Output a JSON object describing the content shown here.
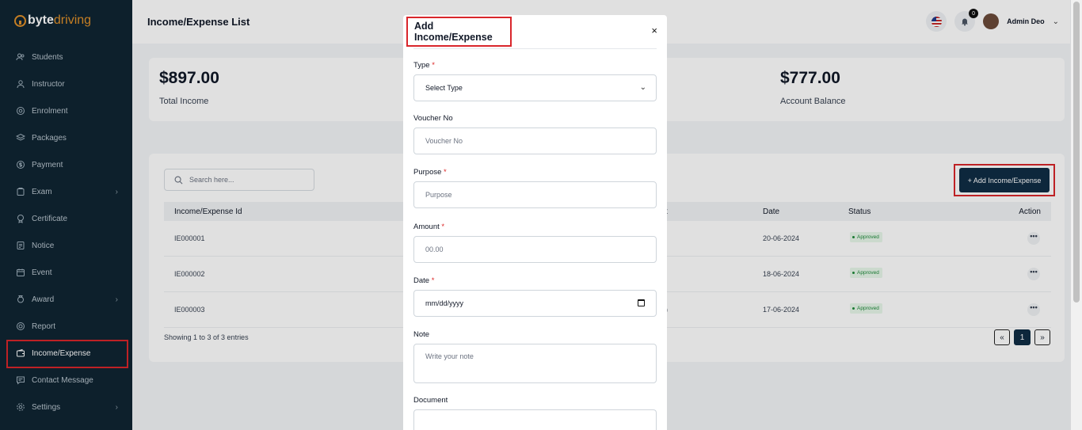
{
  "logo": {
    "part1": "byte",
    "part2": "driving"
  },
  "sidebar": {
    "items": [
      {
        "label": "Students",
        "icon": "users-icon"
      },
      {
        "label": "Instructor",
        "icon": "user-icon"
      },
      {
        "label": "Enrolment",
        "icon": "at-icon"
      },
      {
        "label": "Packages",
        "icon": "layers-icon"
      },
      {
        "label": "Payment",
        "icon": "dollar-icon"
      },
      {
        "label": "Exam",
        "icon": "clipboard-icon"
      },
      {
        "label": "Certificate",
        "icon": "certificate-icon"
      },
      {
        "label": "Notice",
        "icon": "note-icon"
      },
      {
        "label": "Event",
        "icon": "calendar-icon"
      },
      {
        "label": "Award",
        "icon": "award-icon"
      },
      {
        "label": "Report",
        "icon": "report-icon"
      },
      {
        "label": "Income/Expense",
        "icon": "wallet-icon"
      },
      {
        "label": "Contact Message",
        "icon": "message-icon"
      },
      {
        "label": "Settings",
        "icon": "gear-icon"
      }
    ]
  },
  "header": {
    "title": "Income/Expense List",
    "notifications": "0",
    "user": "Admin Deo"
  },
  "stats": [
    {
      "value": "$897.00",
      "label": "Total Income"
    },
    {
      "value": "$777.00",
      "label": "Account Balance"
    }
  ],
  "toolbar": {
    "search_placeholder": "Search here...",
    "add_label": "+ Add Income/Expense"
  },
  "table": {
    "headers": {
      "id": "Income/Expense Id",
      "amount_partial": "t",
      "date": "Date",
      "status": "Status",
      "action": "Action"
    },
    "rows": [
      {
        "id": "IE000001",
        "amount": "",
        "date": "20-06-2024",
        "status": "Approved"
      },
      {
        "id": "IE000002",
        "amount": "",
        "date": "18-06-2024",
        "status": "Approved"
      },
      {
        "id": "IE000003",
        "amount": ")",
        "date": "17-06-2024",
        "status": "Approved"
      }
    ],
    "action_symbol": "•••",
    "showing": "Showing 1 to 3 of 3 entries",
    "pager": {
      "prev": "«",
      "current": "1",
      "next": "»"
    }
  },
  "modal": {
    "title": "Add Income/Expense",
    "close": "×",
    "required_mark": "*",
    "type": {
      "label": "Type",
      "placeholder": "Select Type"
    },
    "voucher": {
      "label": "Voucher No",
      "placeholder": "Voucher No"
    },
    "purpose": {
      "label": "Purpose",
      "placeholder": "Purpose"
    },
    "amount": {
      "label": "Amount",
      "placeholder": "00.00"
    },
    "date": {
      "label": "Date",
      "placeholder": "mm/dd/yyyy"
    },
    "note": {
      "label": "Note",
      "placeholder": "Write your note"
    },
    "document": {
      "label": "Document"
    }
  },
  "colors": {
    "sidebar_bg": "#0f2533",
    "brand_orange": "#e0902a",
    "primary_button": "#0f2d45",
    "highlight_red": "#d9262b",
    "approved_green": "#1e8a3a"
  }
}
